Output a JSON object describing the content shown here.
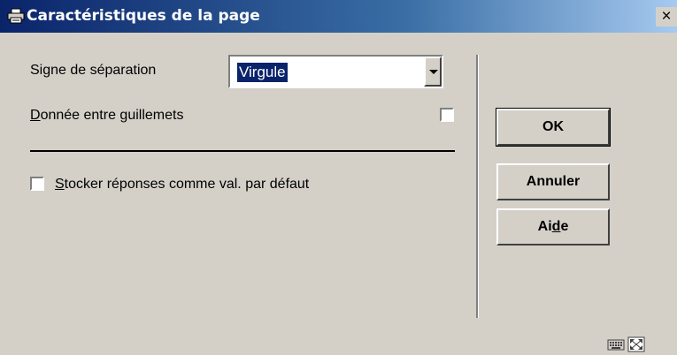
{
  "window": {
    "title": "Caractéristiques de la page",
    "close_label": "×"
  },
  "form": {
    "separator_label": "Signe de séparation",
    "separator_value": "Virgule",
    "quoted_label_rest": "onnée entre guillemets",
    "quoted_label_accel": "D",
    "quoted_checked": false,
    "store_label_accel": "S",
    "store_label_rest": "tocker réponses comme val. par défaut",
    "store_checked": false
  },
  "buttons": {
    "ok_label": "OK",
    "cancel_label": "Annuler",
    "help_label_pre": "Ai",
    "help_label_accel": "d",
    "help_label_post": "e"
  },
  "statusbar": {
    "icons": [
      "keyboard-icon",
      "resize-icon"
    ]
  },
  "colors": {
    "titlebar_start": "#0a246a",
    "titlebar_end": "#a6caf0",
    "dialog_bg": "#d4d0c8",
    "selection_bg": "#0a246a"
  }
}
